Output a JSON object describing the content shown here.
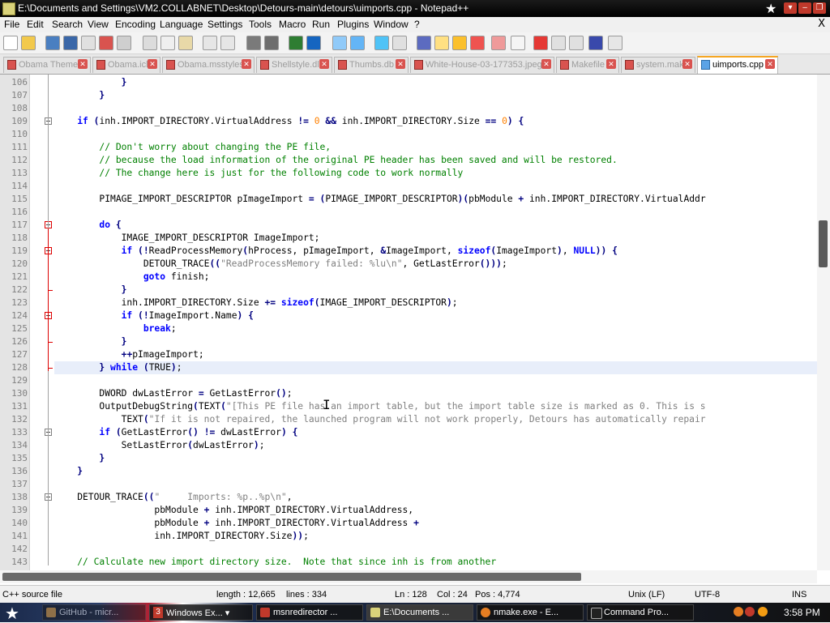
{
  "window": {
    "title": "E:\\Documents and Settings\\VM2.COLLABNET\\Desktop\\Detours-main\\detours\\uimports.cpp - Notepad++",
    "star_glyph": "★",
    "controls": [
      "▾",
      "‒",
      "❐",
      "✕"
    ]
  },
  "menu": [
    "File",
    "Edit",
    "Search",
    "View",
    "Encoding",
    "Language",
    "Settings",
    "Tools",
    "Macro",
    "Run",
    "Plugins",
    "Window",
    "?"
  ],
  "menu_close": "X",
  "tabs": [
    {
      "label": "Obama Theme",
      "active": false
    },
    {
      "label": "Obama.icl",
      "active": false
    },
    {
      "label": "Obama.msstyles",
      "active": false
    },
    {
      "label": "Shellstyle.dll",
      "active": false
    },
    {
      "label": "Thumbs.db",
      "active": false
    },
    {
      "label": "White-House-03-177353.jpeg",
      "active": false
    },
    {
      "label": "Makefile",
      "active": false
    },
    {
      "label": "system.mak",
      "active": false
    },
    {
      "label": "uimports.cpp",
      "active": true
    }
  ],
  "editor": {
    "caret_line": 128,
    "lines": [
      {
        "n": "106",
        "t": "            }"
      },
      {
        "n": "107",
        "t": "        }"
      },
      {
        "n": "108",
        "t": ""
      },
      {
        "n": "109",
        "t": "    if (inh.IMPORT_DIRECTORY.VirtualAddress != 0 && inh.IMPORT_DIRECTORY.Size == 0) {"
      },
      {
        "n": "110",
        "t": ""
      },
      {
        "n": "111",
        "t": "        // Don't worry about changing the PE file,"
      },
      {
        "n": "112",
        "t": "        // because the load information of the original PE header has been saved and will be restored."
      },
      {
        "n": "113",
        "t": "        // The change here is just for the following code to work normally"
      },
      {
        "n": "114",
        "t": ""
      },
      {
        "n": "115",
        "t": "        PIMAGE_IMPORT_DESCRIPTOR pImageImport = (PIMAGE_IMPORT_DESCRIPTOR)(pbModule + inh.IMPORT_DIRECTORY.VirtualAddr"
      },
      {
        "n": "116",
        "t": ""
      },
      {
        "n": "117",
        "t": "        do {"
      },
      {
        "n": "118",
        "t": "            IMAGE_IMPORT_DESCRIPTOR ImageImport;"
      },
      {
        "n": "119",
        "t": "            if (!ReadProcessMemory(hProcess, pImageImport, &ImageImport, sizeof(ImageImport), NULL)) {"
      },
      {
        "n": "120",
        "t": "                DETOUR_TRACE((\"ReadProcessMemory failed: %lu\\n\", GetLastError()));"
      },
      {
        "n": "121",
        "t": "                goto finish;"
      },
      {
        "n": "122",
        "t": "            }"
      },
      {
        "n": "123",
        "t": "            inh.IMPORT_DIRECTORY.Size += sizeof(IMAGE_IMPORT_DESCRIPTOR);"
      },
      {
        "n": "124",
        "t": "            if (!ImageImport.Name) {"
      },
      {
        "n": "125",
        "t": "                break;"
      },
      {
        "n": "126",
        "t": "            }"
      },
      {
        "n": "127",
        "t": "            ++pImageImport;"
      },
      {
        "n": "128",
        "t": "        } while (TRUE);"
      },
      {
        "n": "129",
        "t": ""
      },
      {
        "n": "130",
        "t": "        DWORD dwLastError = GetLastError();"
      },
      {
        "n": "131",
        "t": "        OutputDebugString(TEXT(\"[This PE file has an import table, but the import table size is marked as 0. This is s"
      },
      {
        "n": "132",
        "t": "            TEXT(\"If it is not repaired, the launched program will not work properly, Detours has automatically repair"
      },
      {
        "n": "133",
        "t": "        if (GetLastError() != dwLastError) {"
      },
      {
        "n": "134",
        "t": "            SetLastError(dwLastError);"
      },
      {
        "n": "135",
        "t": "        }"
      },
      {
        "n": "136",
        "t": "    }"
      },
      {
        "n": "137",
        "t": ""
      },
      {
        "n": "138",
        "t": "    DETOUR_TRACE((\"     Imports: %p..%p\\n\","
      },
      {
        "n": "139",
        "t": "                  pbModule + inh.IMPORT_DIRECTORY.VirtualAddress,"
      },
      {
        "n": "140",
        "t": "                  pbModule + inh.IMPORT_DIRECTORY.VirtualAddress +"
      },
      {
        "n": "141",
        "t": "                  inh.IMPORT_DIRECTORY.Size));"
      },
      {
        "n": "142",
        "t": ""
      },
      {
        "n": "143",
        "t": "    // Calculate new import directory size.  Note that since inh is from another"
      }
    ]
  },
  "status": {
    "lang": "C++ source file",
    "length": "length : 12,665",
    "lines": "lines : 334",
    "ln": "Ln : 128",
    "col": "Col : 24",
    "pos": "Pos : 4,774",
    "eol": "Unix (LF)",
    "encoding": "UTF-8",
    "mode": "INS"
  },
  "taskbar": {
    "start": "★",
    "tasks": [
      {
        "label": "GitHub - micr...",
        "badge": ""
      },
      {
        "label": "Windows Ex... ▾",
        "badge": "3"
      },
      {
        "label": "msnredirector ...",
        "badge": ""
      },
      {
        "label": "E:\\Documents ...",
        "badge": ""
      },
      {
        "label": "nmake.exe - E...",
        "badge": ""
      },
      {
        "label": "Command Pro...",
        "badge": ""
      }
    ],
    "clock": "3:58 PM"
  },
  "colors": {
    "keyword": "#0000ff",
    "comment": "#008000",
    "string": "#808080",
    "number": "#ff8000",
    "tab_accent": "#f5a623"
  }
}
